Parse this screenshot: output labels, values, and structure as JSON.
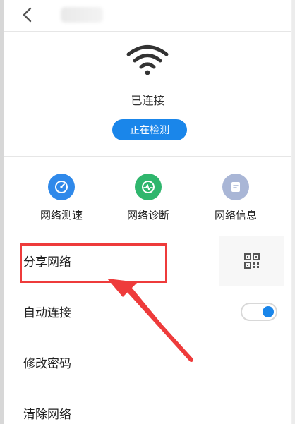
{
  "status": {
    "text": "已连接",
    "detect_label": "正在检测"
  },
  "actions": [
    {
      "label": "网络测速",
      "icon": "speedometer-icon",
      "color": "#2f89ea"
    },
    {
      "label": "网络诊断",
      "icon": "heartbeat-icon",
      "color": "#2fb66d"
    },
    {
      "label": "网络信息",
      "icon": "document-icon",
      "color": "#a9b6d6"
    }
  ],
  "rows": [
    {
      "label": "分享网络",
      "trailing": "qr-code-icon"
    },
    {
      "label": "自动连接",
      "trailing": "toggle",
      "toggle_on": true
    },
    {
      "label": "修改密码"
    },
    {
      "label": "清除网络"
    }
  ],
  "colors": {
    "accent": "#1a86ea",
    "annotation": "#ee3b3b"
  }
}
